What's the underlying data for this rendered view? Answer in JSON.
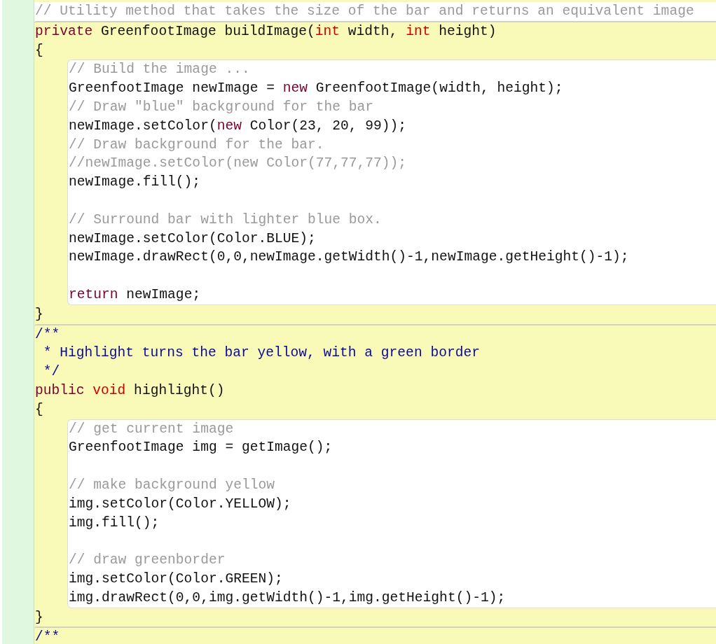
{
  "blocks": [
    {
      "kind": "line",
      "line": {
        "kind": "code",
        "tokens": [
          {
            "text": "// Utility method that takes the size of the bar and returns an equivalent image",
            "kind": "comment"
          }
        ]
      }
    },
    {
      "kind": "method",
      "header": [
        {
          "kind": "code",
          "tokens": [
            {
              "text": "private",
              "kind": "modifier"
            },
            {
              "text": " GreenfootImage buildImage(",
              "kind": "plain"
            },
            {
              "text": "int",
              "kind": "primitive"
            },
            {
              "text": " width, ",
              "kind": "plain"
            },
            {
              "text": "int",
              "kind": "primitive"
            },
            {
              "text": " height)",
              "kind": "plain"
            }
          ]
        },
        {
          "kind": "code",
          "tokens": [
            {
              "text": "{",
              "kind": "plain"
            }
          ]
        }
      ],
      "body": [
        {
          "kind": "code",
          "tokens": [
            {
              "text": "// Build the image ...",
              "kind": "comment"
            }
          ]
        },
        {
          "kind": "code",
          "tokens": [
            {
              "text": "GreenfootImage newImage = ",
              "kind": "plain"
            },
            {
              "text": "new",
              "kind": "modifier"
            },
            {
              "text": " GreenfootImage(width, height);",
              "kind": "plain"
            }
          ]
        },
        {
          "kind": "code",
          "tokens": [
            {
              "text": "// Draw \"blue\" background for the bar",
              "kind": "comment"
            }
          ]
        },
        {
          "kind": "code",
          "tokens": [
            {
              "text": "newImage.setColor(",
              "kind": "plain"
            },
            {
              "text": "new",
              "kind": "modifier"
            },
            {
              "text": " Color(23, 20, 99));",
              "kind": "plain"
            }
          ]
        },
        {
          "kind": "code",
          "tokens": [
            {
              "text": "// Draw background for the bar.",
              "kind": "comment"
            }
          ]
        },
        {
          "kind": "code",
          "tokens": [
            {
              "text": "//newImage.setColor(new Color(77,77,77));",
              "kind": "comment"
            }
          ]
        },
        {
          "kind": "code",
          "tokens": [
            {
              "text": "newImage.fill();",
              "kind": "plain"
            }
          ]
        },
        {
          "kind": "blank"
        },
        {
          "kind": "code",
          "tokens": [
            {
              "text": "// Surround bar with lighter blue box.",
              "kind": "comment"
            }
          ]
        },
        {
          "kind": "code",
          "tokens": [
            {
              "text": "newImage.setColor(Color.BLUE);",
              "kind": "plain"
            }
          ]
        },
        {
          "kind": "code",
          "tokens": [
            {
              "text": "newImage.drawRect(0,0,newImage.getWidth()-1,newImage.getHeight()-1);",
              "kind": "plain"
            }
          ]
        },
        {
          "kind": "blank"
        },
        {
          "kind": "code",
          "tokens": [
            {
              "text": "return",
              "kind": "modifier"
            },
            {
              "text": " newImage;",
              "kind": "plain"
            }
          ]
        }
      ],
      "footer": [
        {
          "kind": "code",
          "tokens": [
            {
              "text": "}",
              "kind": "plain"
            }
          ]
        }
      ]
    },
    {
      "kind": "method",
      "header": [
        {
          "kind": "code",
          "tokens": [
            {
              "text": "/**",
              "kind": "javadoc"
            }
          ]
        },
        {
          "kind": "code",
          "tokens": [
            {
              "text": " * Highlight turns the bar yellow, with a green border",
              "kind": "javadoc"
            }
          ]
        },
        {
          "kind": "code",
          "tokens": [
            {
              "text": " */",
              "kind": "javadoc"
            }
          ]
        },
        {
          "kind": "code",
          "tokens": [
            {
              "text": "public ",
              "kind": "modifier"
            },
            {
              "text": "void",
              "kind": "primitive"
            },
            {
              "text": " highlight()",
              "kind": "plain"
            }
          ]
        },
        {
          "kind": "code",
          "tokens": [
            {
              "text": "{",
              "kind": "plain"
            }
          ]
        }
      ],
      "body": [
        {
          "kind": "code",
          "tokens": [
            {
              "text": "// get current image",
              "kind": "comment"
            }
          ]
        },
        {
          "kind": "code",
          "tokens": [
            {
              "text": "GreenfootImage img = getImage();",
              "kind": "plain"
            }
          ]
        },
        {
          "kind": "blank"
        },
        {
          "kind": "code",
          "tokens": [
            {
              "text": "// make background yellow",
              "kind": "comment"
            }
          ]
        },
        {
          "kind": "code",
          "tokens": [
            {
              "text": "img.setColor(Color.YELLOW);",
              "kind": "plain"
            }
          ]
        },
        {
          "kind": "code",
          "tokens": [
            {
              "text": "img.fill();",
              "kind": "plain"
            }
          ]
        },
        {
          "kind": "blank"
        },
        {
          "kind": "code",
          "tokens": [
            {
              "text": "// draw greenborder",
              "kind": "comment"
            }
          ]
        },
        {
          "kind": "code",
          "tokens": [
            {
              "text": "img.setColor(Color.GREEN);",
              "kind": "plain"
            }
          ]
        },
        {
          "kind": "code",
          "tokens": [
            {
              "text": "img.drawRect(0,0,img.getWidth()-1,img.getHeight()-1);",
              "kind": "plain"
            }
          ]
        }
      ],
      "footer": [
        {
          "kind": "code",
          "tokens": [
            {
              "text": "}",
              "kind": "plain"
            }
          ]
        }
      ]
    },
    {
      "kind": "method",
      "header": [
        {
          "kind": "code",
          "tokens": [
            {
              "text": "/**",
              "kind": "javadoc"
            }
          ]
        }
      ]
    }
  ]
}
